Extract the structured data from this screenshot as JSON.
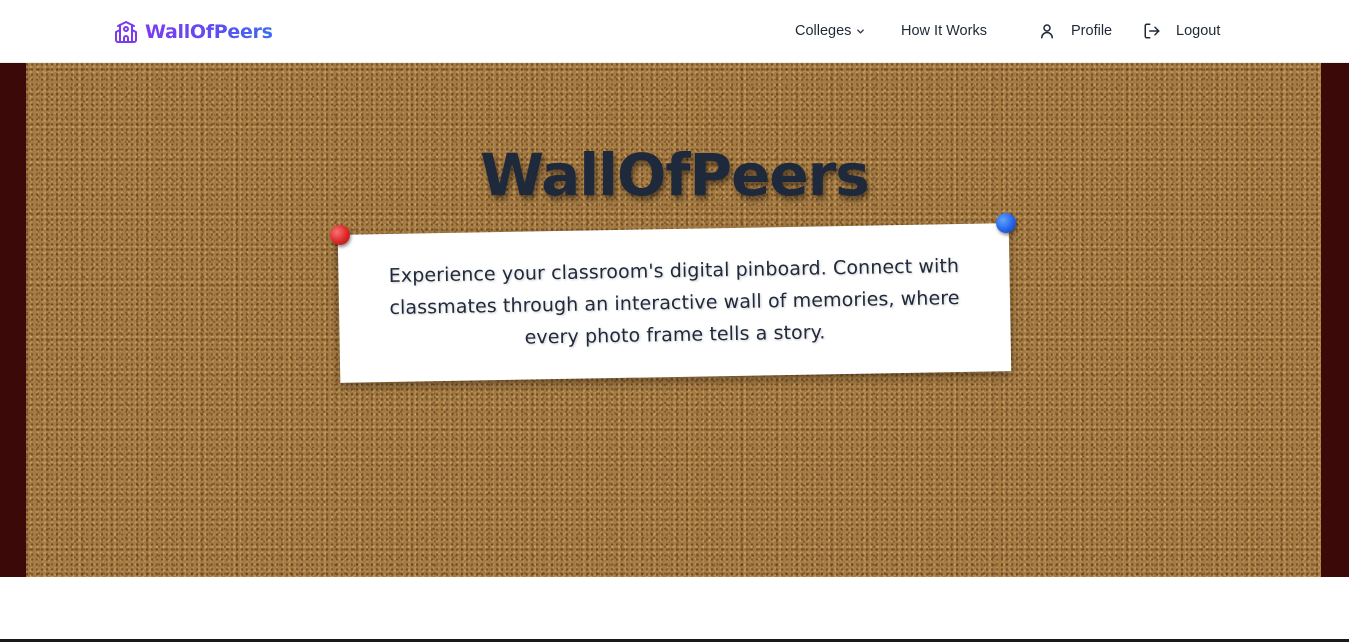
{
  "nav": {
    "brand": "WallOfPeers",
    "colleges_label": "Colleges",
    "how_it_works_label": "How It Works",
    "profile_label": "Profile",
    "logout_label": "Logout"
  },
  "hero": {
    "title": "WallOfPeers",
    "tagline": "Experience your classroom's digital pinboard. Connect with classmates through an interactive wall of memories, where every photo frame tells a story."
  },
  "icons": {
    "brand": "school-building-icon",
    "colleges_dropdown": "chevron-down-icon",
    "profile": "user-icon",
    "logout": "logout-icon"
  },
  "colors": {
    "brand_gradient_start": "#7e3af2",
    "brand_gradient_end": "#3b6ef0",
    "cork": "#a57a43",
    "frame": "#3b0a08",
    "title": "#1e293b",
    "pin_red": "#dc2626",
    "pin_blue": "#2563eb"
  }
}
